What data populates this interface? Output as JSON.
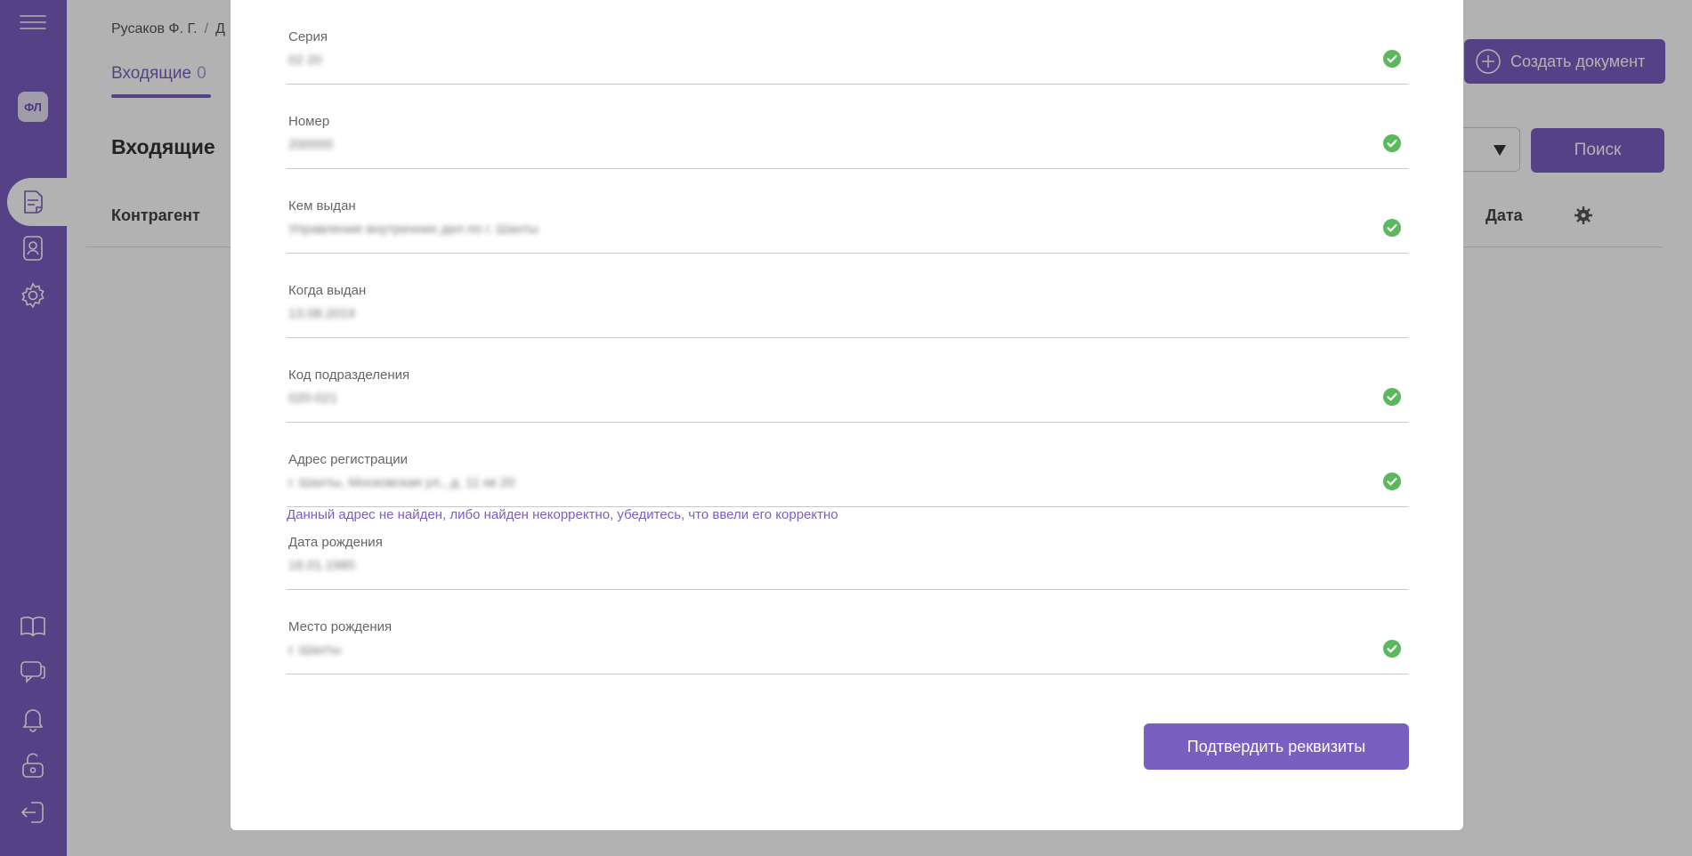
{
  "sidebar": {
    "avatar_initials": "ФЛ",
    "icons": [
      "menu-icon",
      "document-icon",
      "contacts-icon",
      "gear-icon",
      "book-icon",
      "help-chat-icon",
      "bell-icon",
      "unlock-icon",
      "logout-icon"
    ]
  },
  "header": {
    "breadcrumb": {
      "user": "Русаков Ф. Г.",
      "separator": "/",
      "next_fragment": "Д"
    },
    "tab": {
      "label": "Входящие",
      "count": "0"
    },
    "create_button": "Создать документ",
    "search_button": "Поиск"
  },
  "main": {
    "title": "Входящие",
    "columns": {
      "counterparty": "Контрагент",
      "date": "Дата"
    }
  },
  "modal": {
    "fields": [
      {
        "label": "Серия",
        "value": "02 20",
        "valid": true
      },
      {
        "label": "Номер",
        "value": "200000",
        "valid": true
      },
      {
        "label": "Кем выдан",
        "value": "Управление внутренних дел по г. Шахты",
        "valid": true
      },
      {
        "label": "Когда выдан",
        "value": "13.08.2019",
        "valid": false
      },
      {
        "label": "Код подразделения",
        "value": "020-021",
        "valid": true
      },
      {
        "label": "Адрес регистрации",
        "value": "г. Шахты, Московская ул., д. 11 кв 20",
        "valid": true
      },
      {
        "label": "Дата рождения",
        "value": "16.01.1985",
        "valid": false
      },
      {
        "label": "Место рождения",
        "value": "г. Шахты",
        "valid": true
      }
    ],
    "address_error": "Данный адрес не найден, либо найден некорректно, убедитесь, что ввели его корректно",
    "confirm_button": "Подтвердить реквизиты"
  },
  "colors": {
    "accent": "#7a5fc0",
    "success": "#5cb85c",
    "error_text": "#7a5fc0"
  }
}
